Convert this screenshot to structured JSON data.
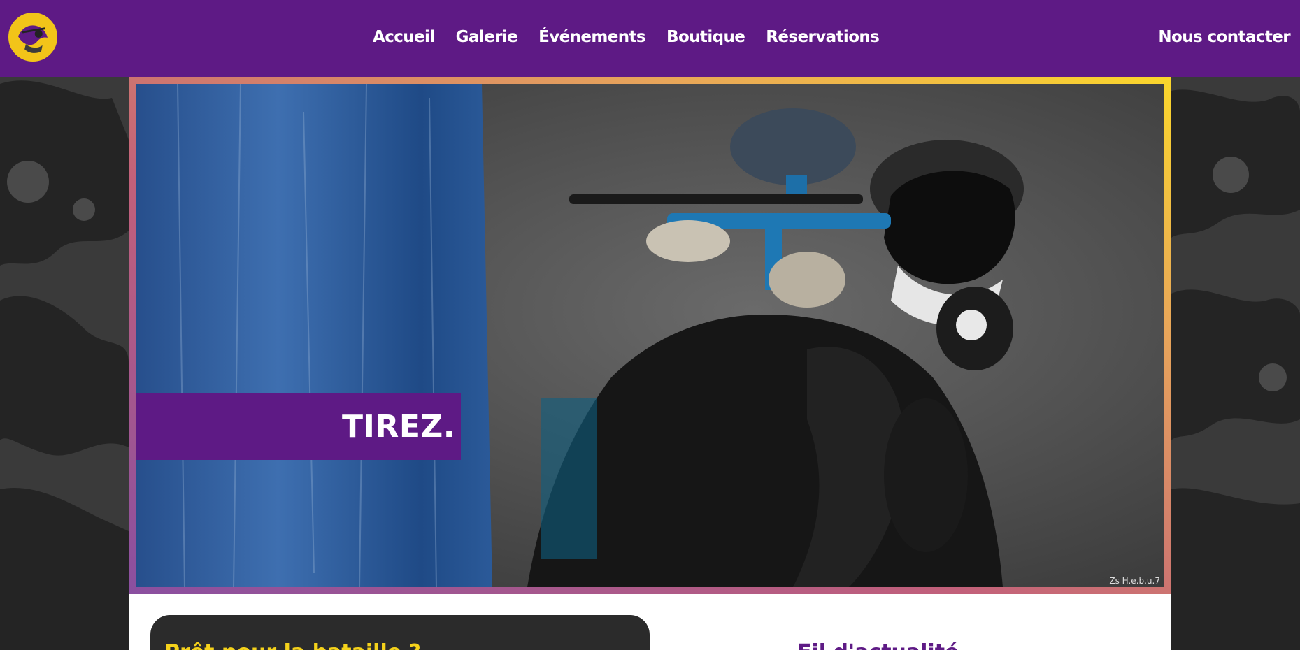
{
  "header": {
    "logo_name": "paintball-logo",
    "nav": [
      {
        "label": "Accueil"
      },
      {
        "label": "Galerie"
      },
      {
        "label": "Événements"
      },
      {
        "label": "Boutique"
      },
      {
        "label": "Réservations"
      }
    ],
    "contact_label": "Nous contacter"
  },
  "hero": {
    "caption": "TIREZ.",
    "watermark": "Zs H.e.b.u.7"
  },
  "sections": {
    "card_title": "Prêt pour la bataille ?",
    "news_title": "Fil d'actualité"
  },
  "colors": {
    "brand_purple": "#5e1a85",
    "accent_yellow": "#f5d21b",
    "dark": "#2b2b2b"
  }
}
